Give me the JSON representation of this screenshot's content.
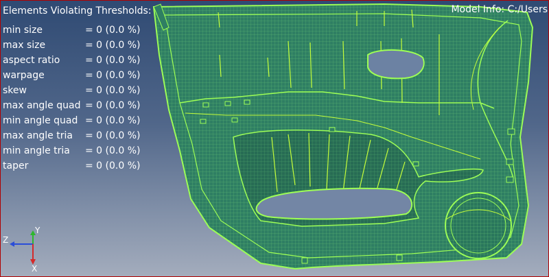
{
  "stats": {
    "title": "Elements Violating Thresholds:",
    "rows": [
      {
        "label": "min size",
        "value": "= 0 (0.0 %)"
      },
      {
        "label": "max size",
        "value": "= 0 (0.0 %)"
      },
      {
        "label": "aspect ratio",
        "value": "= 0 (0.0 %)"
      },
      {
        "label": "warpage",
        "value": "= 0 (0.0 %)"
      },
      {
        "label": "skew",
        "value": "= 0 (0.0 %)"
      },
      {
        "label": "max angle quad",
        "value": "= 0 (0.0 %)"
      },
      {
        "label": "min angle quad",
        "value": "= 0 (0.0 %)"
      },
      {
        "label": "max angle tria",
        "value": "= 0 (0.0 %)"
      },
      {
        "label": "min angle tria",
        "value": "= 0 (0.0 %)"
      },
      {
        "label": "taper",
        "value": "= 0 (0.0 %)"
      }
    ]
  },
  "model_info": "Model Info: C:/Users",
  "triad": {
    "y": "Y",
    "z": "Z",
    "x": "X"
  },
  "colors": {
    "mesh_fill": "#2f7f63",
    "mesh_lines": "#7fe07a",
    "feature_lines": "#c6ff3a",
    "outline": "#9eff55"
  }
}
